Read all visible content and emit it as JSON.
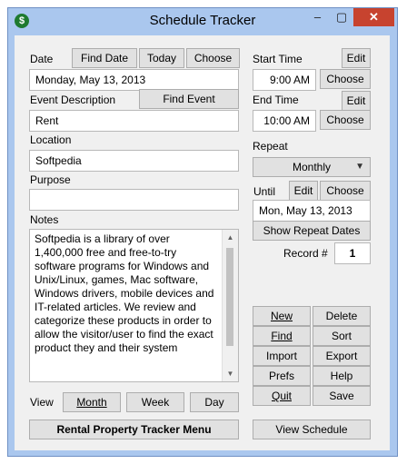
{
  "window": {
    "title": "Schedule Tracker",
    "icon": "app-icon",
    "app_icon_glyph": "$",
    "minimize": "–",
    "maximize": "▢",
    "close": "✕"
  },
  "date": {
    "label": "Date",
    "find_date": "Find Date",
    "today": "Today",
    "choose": "Choose",
    "value": "Monday, May 13, 2013"
  },
  "event_description": {
    "label": "Event Description",
    "find_event": "Find Event",
    "value": "Rent"
  },
  "location": {
    "label": "Location",
    "value": "Softpedia"
  },
  "purpose": {
    "label": "Purpose",
    "value": ""
  },
  "notes": {
    "label": "Notes",
    "value": "Softpedia is a library of over 1,400,000 free and free-to-try software programs for Windows and Unix/Linux, games, Mac software, Windows drivers, mobile devices and IT-related articles. We review and categorize these products in order to allow the visitor/user to find the exact product they and their system"
  },
  "view": {
    "label": "View",
    "month": "Month",
    "week": "Week",
    "day": "Day"
  },
  "start_time": {
    "label": "Start Time",
    "edit": "Edit",
    "value": "9:00 AM",
    "choose": "Choose"
  },
  "end_time": {
    "label": "End Time",
    "edit": "Edit",
    "value": "10:00 AM",
    "choose": "Choose"
  },
  "repeat": {
    "label": "Repeat",
    "selected": "Monthly"
  },
  "until": {
    "label": "Until",
    "edit": "Edit",
    "choose": "Choose",
    "value": "Mon, May 13, 2013",
    "show_repeat_dates": "Show Repeat Dates"
  },
  "record": {
    "label": "Record #",
    "value": "1"
  },
  "actions": {
    "new": "New",
    "delete": "Delete",
    "find": "Find",
    "sort": "Sort",
    "import": "Import",
    "export": "Export",
    "prefs": "Prefs",
    "help": "Help",
    "quit": "Quit",
    "save": "Save"
  },
  "bottom": {
    "rental_menu": "Rental Property Tracker Menu",
    "view_schedule": "View Schedule"
  }
}
